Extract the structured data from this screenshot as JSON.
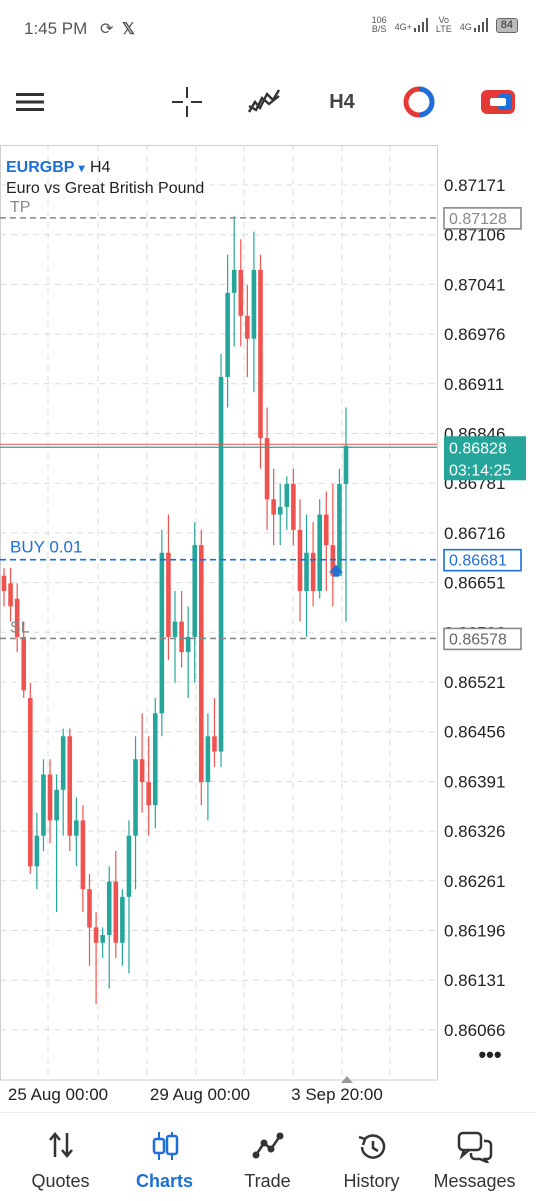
{
  "status_bar": {
    "time": "1:45 PM",
    "net_speed_top": "106",
    "net_speed_bottom": "B/S",
    "signal1": "4G+",
    "volte_top": "Vo",
    "volte_bottom": "LTE",
    "signal2": "4G",
    "battery": "84"
  },
  "toolbar": {
    "timeframe_label": "H4",
    "icons": [
      "menu-icon",
      "crosshair-icon",
      "indicators-icon",
      "timeframe",
      "object-icon",
      "trade-toggle-icon"
    ]
  },
  "chart": {
    "symbol": "EURGBP",
    "symbol_arrow": "▾",
    "timeframe": "H4",
    "description": "Euro vs Great British Pound",
    "tp_label": "TP",
    "tp_price": "0.87128",
    "buy_label": "BUY 0.01",
    "buy_price": "0.86681",
    "sl_label": "SL",
    "sl_price": "0.86578",
    "bid_price": "0.86828",
    "countdown": "03:14:25",
    "more_label": "•••",
    "colors": {
      "up": "#26a69a",
      "down": "#ef5350",
      "buy": "#1e6fd9",
      "level": "#888888",
      "bid": "#26a69a",
      "ask": "#ef5350"
    }
  },
  "chart_data": {
    "type": "candlestick",
    "y_ticks": [
      "0.87171",
      "0.87106",
      "0.87041",
      "0.86976",
      "0.86911",
      "0.86846",
      "0.86781",
      "0.86716",
      "0.86651",
      "0.86586",
      "0.86521",
      "0.86456",
      "0.86391",
      "0.86326",
      "0.86261",
      "0.86196",
      "0.86131",
      "0.86066"
    ],
    "x_ticks": [
      "25 Aug 00:00",
      "29 Aug 00:00",
      "3 Sep 20:00"
    ],
    "ylim": [
      0.8604,
      0.8721
    ],
    "candles": [
      {
        "o": 0.8666,
        "h": 0.8667,
        "l": 0.8662,
        "c": 0.8664
      },
      {
        "o": 0.8665,
        "h": 0.8667,
        "l": 0.866,
        "c": 0.8662
      },
      {
        "o": 0.8663,
        "h": 0.8665,
        "l": 0.8656,
        "c": 0.8658
      },
      {
        "o": 0.8658,
        "h": 0.866,
        "l": 0.865,
        "c": 0.8651
      },
      {
        "o": 0.865,
        "h": 0.8652,
        "l": 0.8627,
        "c": 0.8628
      },
      {
        "o": 0.8628,
        "h": 0.8635,
        "l": 0.8625,
        "c": 0.8632
      },
      {
        "o": 0.8632,
        "h": 0.8642,
        "l": 0.863,
        "c": 0.864
      },
      {
        "o": 0.864,
        "h": 0.8642,
        "l": 0.8631,
        "c": 0.8634
      },
      {
        "o": 0.8634,
        "h": 0.864,
        "l": 0.8622,
        "c": 0.8638
      },
      {
        "o": 0.8638,
        "h": 0.8646,
        "l": 0.8632,
        "c": 0.8645
      },
      {
        "o": 0.8645,
        "h": 0.8646,
        "l": 0.863,
        "c": 0.8632
      },
      {
        "o": 0.8632,
        "h": 0.8637,
        "l": 0.8628,
        "c": 0.8634
      },
      {
        "o": 0.8634,
        "h": 0.8636,
        "l": 0.8622,
        "c": 0.8625
      },
      {
        "o": 0.8625,
        "h": 0.8627,
        "l": 0.8615,
        "c": 0.862
      },
      {
        "o": 0.862,
        "h": 0.8622,
        "l": 0.861,
        "c": 0.8618
      },
      {
        "o": 0.8618,
        "h": 0.862,
        "l": 0.8616,
        "c": 0.8619
      },
      {
        "o": 0.8619,
        "h": 0.8628,
        "l": 0.8612,
        "c": 0.8626
      },
      {
        "o": 0.8626,
        "h": 0.863,
        "l": 0.8616,
        "c": 0.8618
      },
      {
        "o": 0.8618,
        "h": 0.8625,
        "l": 0.8615,
        "c": 0.8624
      },
      {
        "o": 0.8624,
        "h": 0.8634,
        "l": 0.8614,
        "c": 0.8632
      },
      {
        "o": 0.8632,
        "h": 0.8645,
        "l": 0.8625,
        "c": 0.8642
      },
      {
        "o": 0.8642,
        "h": 0.8648,
        "l": 0.8635,
        "c": 0.8639
      },
      {
        "o": 0.8639,
        "h": 0.8645,
        "l": 0.8632,
        "c": 0.8636
      },
      {
        "o": 0.8636,
        "h": 0.865,
        "l": 0.8633,
        "c": 0.8648
      },
      {
        "o": 0.8648,
        "h": 0.8672,
        "l": 0.8645,
        "c": 0.8669
      },
      {
        "o": 0.8669,
        "h": 0.8674,
        "l": 0.8655,
        "c": 0.8658
      },
      {
        "o": 0.8658,
        "h": 0.8664,
        "l": 0.8652,
        "c": 0.866
      },
      {
        "o": 0.866,
        "h": 0.8664,
        "l": 0.8654,
        "c": 0.8656
      },
      {
        "o": 0.8656,
        "h": 0.8662,
        "l": 0.865,
        "c": 0.8658
      },
      {
        "o": 0.8658,
        "h": 0.8673,
        "l": 0.8652,
        "c": 0.867
      },
      {
        "o": 0.867,
        "h": 0.8672,
        "l": 0.8636,
        "c": 0.8639
      },
      {
        "o": 0.8639,
        "h": 0.8648,
        "l": 0.8634,
        "c": 0.8645
      },
      {
        "o": 0.8645,
        "h": 0.865,
        "l": 0.8641,
        "c": 0.8643
      },
      {
        "o": 0.8643,
        "h": 0.8695,
        "l": 0.8641,
        "c": 0.8692
      },
      {
        "o": 0.8692,
        "h": 0.8708,
        "l": 0.8688,
        "c": 0.8703
      },
      {
        "o": 0.8703,
        "h": 0.8713,
        "l": 0.8696,
        "c": 0.8706
      },
      {
        "o": 0.8706,
        "h": 0.871,
        "l": 0.8696,
        "c": 0.87
      },
      {
        "o": 0.87,
        "h": 0.8704,
        "l": 0.8692,
        "c": 0.8697
      },
      {
        "o": 0.8697,
        "h": 0.8711,
        "l": 0.869,
        "c": 0.8706
      },
      {
        "o": 0.8706,
        "h": 0.8708,
        "l": 0.868,
        "c": 0.8684
      },
      {
        "o": 0.8684,
        "h": 0.8688,
        "l": 0.8672,
        "c": 0.8676
      },
      {
        "o": 0.8676,
        "h": 0.868,
        "l": 0.867,
        "c": 0.8674
      },
      {
        "o": 0.8674,
        "h": 0.8678,
        "l": 0.867,
        "c": 0.8675
      },
      {
        "o": 0.8675,
        "h": 0.8679,
        "l": 0.8672,
        "c": 0.8678
      },
      {
        "o": 0.8678,
        "h": 0.868,
        "l": 0.867,
        "c": 0.8672
      },
      {
        "o": 0.8672,
        "h": 0.8676,
        "l": 0.866,
        "c": 0.8664
      },
      {
        "o": 0.8664,
        "h": 0.8674,
        "l": 0.8658,
        "c": 0.8669
      },
      {
        "o": 0.8669,
        "h": 0.8673,
        "l": 0.8662,
        "c": 0.8664
      },
      {
        "o": 0.8664,
        "h": 0.8676,
        "l": 0.8663,
        "c": 0.8674
      },
      {
        "o": 0.8674,
        "h": 0.8677,
        "l": 0.8664,
        "c": 0.867
      },
      {
        "o": 0.867,
        "h": 0.8678,
        "l": 0.8662,
        "c": 0.8666
      },
      {
        "o": 0.8666,
        "h": 0.868,
        "l": 0.8666,
        "c": 0.8678
      },
      {
        "o": 0.8678,
        "h": 0.8688,
        "l": 0.866,
        "c": 0.8683
      }
    ]
  },
  "nav": {
    "items": [
      {
        "label": "Quotes",
        "icon": "quotes-icon"
      },
      {
        "label": "Charts",
        "icon": "charts-icon"
      },
      {
        "label": "Trade",
        "icon": "trade-icon"
      },
      {
        "label": "History",
        "icon": "history-icon"
      },
      {
        "label": "Messages",
        "icon": "messages-icon"
      }
    ],
    "active_index": 1
  }
}
